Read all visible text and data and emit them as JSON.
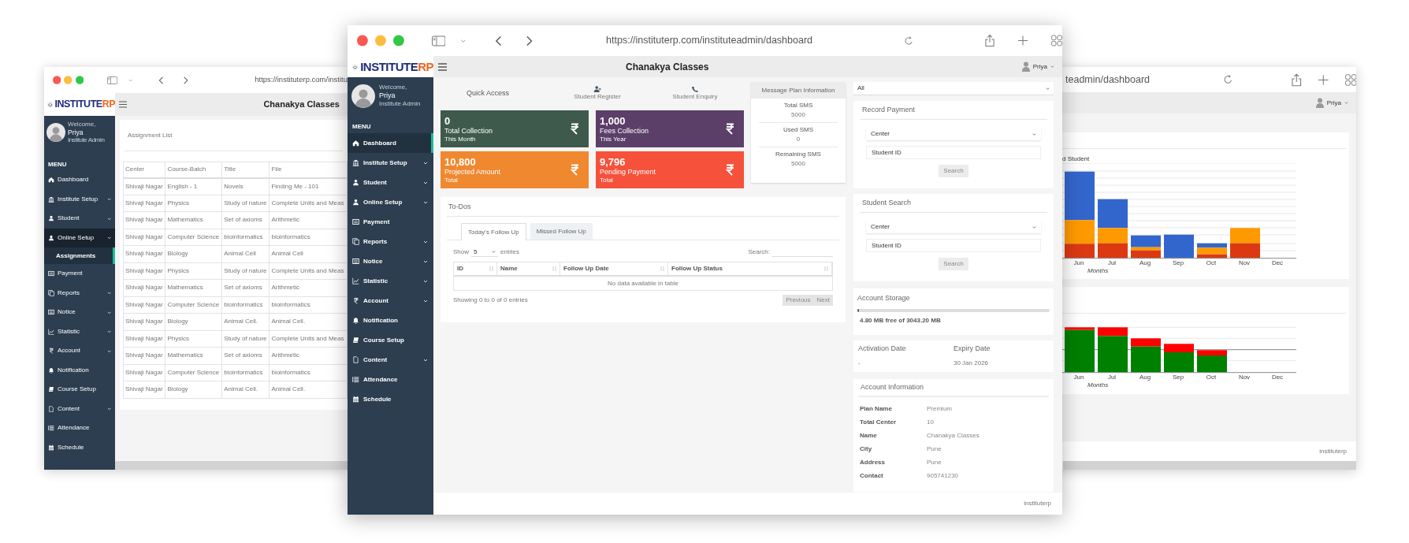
{
  "left_window": {
    "url": "https://instituterp.com/institu",
    "logo": [
      "INSTITUTE",
      "RP"
    ],
    "header_title": "Chanakya Classes",
    "profile": {
      "greeting": "Welcome,",
      "name": "Priya",
      "role": "Institute Admin"
    },
    "menu_label": "MENU",
    "sidebar_items": [
      {
        "label": "Dashboard",
        "submenu": false,
        "expanded": false,
        "selected": false
      },
      {
        "label": "Institute Setup",
        "submenu": true,
        "expanded": false,
        "selected": false
      },
      {
        "label": "Student",
        "submenu": true,
        "expanded": false,
        "selected": false
      },
      {
        "label": "Online Setup",
        "submenu": true,
        "expanded": true,
        "selected": false,
        "children": [
          {
            "label": "Assignments",
            "selected": true
          }
        ]
      },
      {
        "label": "Payment",
        "submenu": false,
        "expanded": false,
        "selected": false
      },
      {
        "label": "Reports",
        "submenu": true,
        "expanded": false,
        "selected": false
      },
      {
        "label": "Notice",
        "submenu": true,
        "expanded": false,
        "selected": false
      },
      {
        "label": "Statistic",
        "submenu": true,
        "expanded": false,
        "selected": false
      },
      {
        "label": "Account",
        "submenu": true,
        "expanded": false,
        "selected": false
      },
      {
        "label": "Notification",
        "submenu": false,
        "expanded": false,
        "selected": false
      },
      {
        "label": "Course Setup",
        "submenu": false,
        "expanded": false,
        "selected": false
      },
      {
        "label": "Content",
        "submenu": true,
        "expanded": false,
        "selected": false
      },
      {
        "label": "Attendance",
        "submenu": false,
        "expanded": false,
        "selected": false
      },
      {
        "label": "Schedule",
        "submenu": false,
        "expanded": false,
        "selected": false
      }
    ],
    "card_title": "Assignment List",
    "table": {
      "columns": [
        "Center",
        "Course-Batch",
        "Title",
        "File"
      ],
      "rows": [
        [
          "Shivaji Nagar",
          "English - 1",
          "Novels",
          "Finding Me - 101"
        ],
        [
          "Shivaji Nagar",
          "Physics",
          "Study of nature",
          "Complete Units and Meas"
        ],
        [
          "Shivaji Nagar",
          "Mathematics",
          "Set of axioms",
          "Arithmetic"
        ],
        [
          "Shivaji Nagar",
          "Computer Science",
          "bioinformatics",
          "bioinformatics"
        ],
        [
          "Shivaji Nagar",
          "Biology",
          "Animal Cell",
          "Animal Cell"
        ],
        [
          "Shivaji Nagar",
          "Physics",
          "Study of nature",
          "Complete Units and Meas"
        ],
        [
          "Shivaji Nagar",
          "Mathematics",
          "Set of axioms",
          "Arithmetic"
        ],
        [
          "Shivaji Nagar",
          "Computer Science",
          "bioinformatics",
          "bioinformatics"
        ],
        [
          "Shivaji Nagar",
          "Biology",
          "Animal Cell.",
          "Animal Cell."
        ],
        [
          "Shivaji Nagar",
          "Physics",
          "Study of nature",
          "Complete Units and Meas"
        ],
        [
          "Shivaji Nagar",
          "Mathematics",
          "Set of axioms",
          "Arithmetic"
        ],
        [
          "Shivaji Nagar",
          "Computer Science",
          "bioinformatics",
          "bioinformatics"
        ],
        [
          "Shivaji Nagar",
          "Biology",
          "Animal Cell.",
          "Animal Cell."
        ]
      ]
    }
  },
  "front_window": {
    "url": "https://instituterp.com/instituteadmin/dashboard",
    "logo": [
      "INSTITUTE",
      "RP"
    ],
    "header_title": "Chanakya Classes",
    "user_name": "Priya",
    "profile": {
      "greeting": "Welcome,",
      "name": "Priya",
      "role": "Institute Admin"
    },
    "menu_label": "MENU",
    "sidebar_items": [
      {
        "label": "Dashboard",
        "submenu": false,
        "selected": true
      },
      {
        "label": "Institute Setup",
        "submenu": true,
        "selected": false
      },
      {
        "label": "Student",
        "submenu": true,
        "selected": false
      },
      {
        "label": "Online Setup",
        "submenu": true,
        "selected": false
      },
      {
        "label": "Payment",
        "submenu": false,
        "selected": false
      },
      {
        "label": "Reports",
        "submenu": true,
        "selected": false
      },
      {
        "label": "Notice",
        "submenu": true,
        "selected": false
      },
      {
        "label": "Statistic",
        "submenu": true,
        "selected": false
      },
      {
        "label": "Account",
        "submenu": true,
        "selected": false
      },
      {
        "label": "Notification",
        "submenu": false,
        "selected": false
      },
      {
        "label": "Course Setup",
        "submenu": false,
        "selected": false
      },
      {
        "label": "Content",
        "submenu": true,
        "selected": false
      },
      {
        "label": "Attendance",
        "submenu": false,
        "selected": false
      },
      {
        "label": "Schedule",
        "submenu": false,
        "selected": false
      }
    ],
    "quick_access": {
      "title": "Quick Access",
      "links": [
        "Student Register",
        "Student Enquiry"
      ]
    },
    "stat_cards": [
      {
        "value": "0",
        "label": "Total Collection",
        "period": "This Month",
        "color": "#3e5a4c"
      },
      {
        "value": "1,000",
        "label": "Fees Collection",
        "period": "This Year",
        "color": "#5b3f69"
      },
      {
        "value": "10,800",
        "label": "Projected Amount",
        "period": "Total",
        "color": "#f0882f"
      },
      {
        "value": "9,796",
        "label": "Pending Payment",
        "period": "Total",
        "color": "#f6513b"
      }
    ],
    "message_plan": {
      "title": "Message Plan Information",
      "rows": [
        {
          "label": "Total SMS",
          "value": "5000"
        },
        {
          "label": "Used SMS",
          "value": "0"
        },
        {
          "label": "Remaining SMS",
          "value": "5000"
        }
      ]
    },
    "todos": {
      "title": "To-Dos",
      "tabs": [
        {
          "label": "Today's Follow Up",
          "selected": true
        },
        {
          "label": "Missed Follow Up",
          "selected": false
        }
      ],
      "show_label": "Show",
      "page_size": "5",
      "entries_label": "entries",
      "search_label": "Search:",
      "columns": [
        "ID",
        "Name",
        "Follow Up Date",
        "Follow Up Status"
      ],
      "empty_message": "No data available in table",
      "info": "Showing 0 to 0 of 0 entries",
      "pager": [
        "Previous",
        "Next"
      ]
    },
    "filter_select": "All",
    "record_payment": {
      "title": "Record Payment",
      "select": "Center",
      "placeholder": "Student ID",
      "button": "Search"
    },
    "student_search": {
      "title": "Student Search",
      "select": "Center",
      "placeholder": "Student ID",
      "button": "Search"
    },
    "storage": {
      "title": "Account Storage",
      "level": 0.01,
      "text": "4.80 MB free of 3043.20 MB"
    },
    "dates": [
      {
        "label": "Activation Date",
        "value": "-"
      },
      {
        "label": "Expiry Date",
        "value": "30 Jan 2026"
      }
    ],
    "account_info": {
      "title": "Account Information",
      "rows": [
        {
          "label": "Plan Name",
          "value": "Premium"
        },
        {
          "label": "Total Center",
          "value": "10"
        },
        {
          "label": "Name",
          "value": "Chanakya Classes"
        },
        {
          "label": "City",
          "value": "Pune"
        },
        {
          "label": "Address",
          "value": "Pune"
        },
        {
          "label": "Contact",
          "value": "905741230"
        }
      ]
    },
    "footer": "instituterp"
  },
  "right_window": {
    "url": "teadmin/dashboard",
    "user_name": "Priya",
    "charts": [
      {
        "title": "d Student",
        "x_labels": [
          "Jun",
          "Jul",
          "Aug",
          "Sep",
          "Oct",
          "Nov",
          "Dec"
        ],
        "x_title": "Months"
      },
      {
        "x_labels": [
          "Jun",
          "Jul",
          "Aug",
          "Sep",
          "Oct",
          "Nov",
          "Dec"
        ],
        "x_title": "Months"
      }
    ],
    "footer": "instituterp"
  }
}
